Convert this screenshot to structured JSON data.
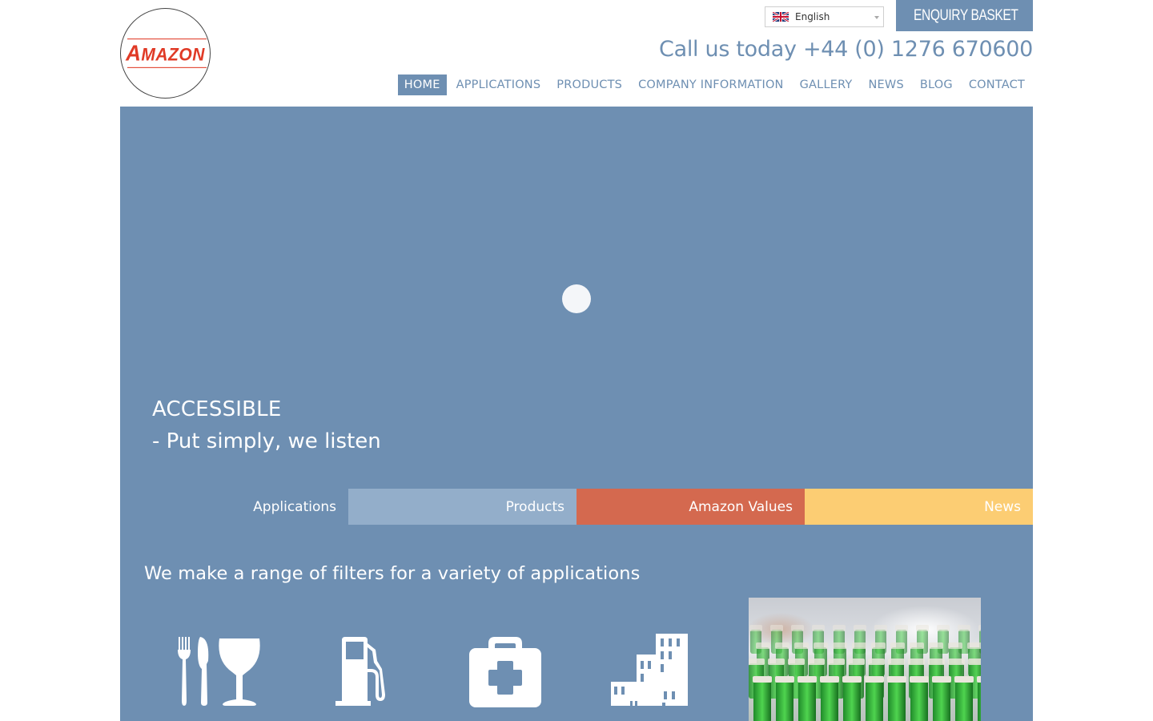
{
  "brand": {
    "logo_text_initial": "A",
    "logo_text_rest": "MAZON",
    "logo_color": "#e03a26"
  },
  "header": {
    "language": {
      "selected": "English",
      "flag_icon": "uk-flag-icon"
    },
    "basket": {
      "label": "ENQUIRY BASKET",
      "icon": "cart-icon"
    },
    "phone_text": "Call us today +44 (0) 1276 670600"
  },
  "nav": {
    "items": [
      {
        "label": "HOME",
        "active": true
      },
      {
        "label": "APPLICATIONS",
        "active": false
      },
      {
        "label": "PRODUCTS",
        "active": false
      },
      {
        "label": "COMPANY INFORMATION",
        "active": false
      },
      {
        "label": "GALLERY",
        "active": false
      },
      {
        "label": "NEWS",
        "active": false
      },
      {
        "label": "BLOG",
        "active": false
      },
      {
        "label": "CONTACT",
        "active": false
      }
    ]
  },
  "hero": {
    "title": "ACCESSIBLE",
    "subtitle": "- Put simply, we listen"
  },
  "tabs": [
    {
      "label": "Applications",
      "color": "#6e8fb2"
    },
    {
      "label": "Products",
      "color": "#93aeca"
    },
    {
      "label": "Amazon Values",
      "color": "#d4694f"
    },
    {
      "label": "News",
      "color": "#fccd73"
    }
  ],
  "applications": {
    "heading": "We make a range of filters for a variety of applications",
    "icons": [
      "food-and-beverage-icon",
      "fuel-pump-icon",
      "first-aid-kit-icon",
      "buildings-icon"
    ],
    "photo": "green-bottles-production-line-photo"
  },
  "colors": {
    "primary": "#6e8fb2",
    "products_tab": "#93aeca",
    "values_tab": "#d4694f",
    "news_tab": "#fccd73"
  }
}
